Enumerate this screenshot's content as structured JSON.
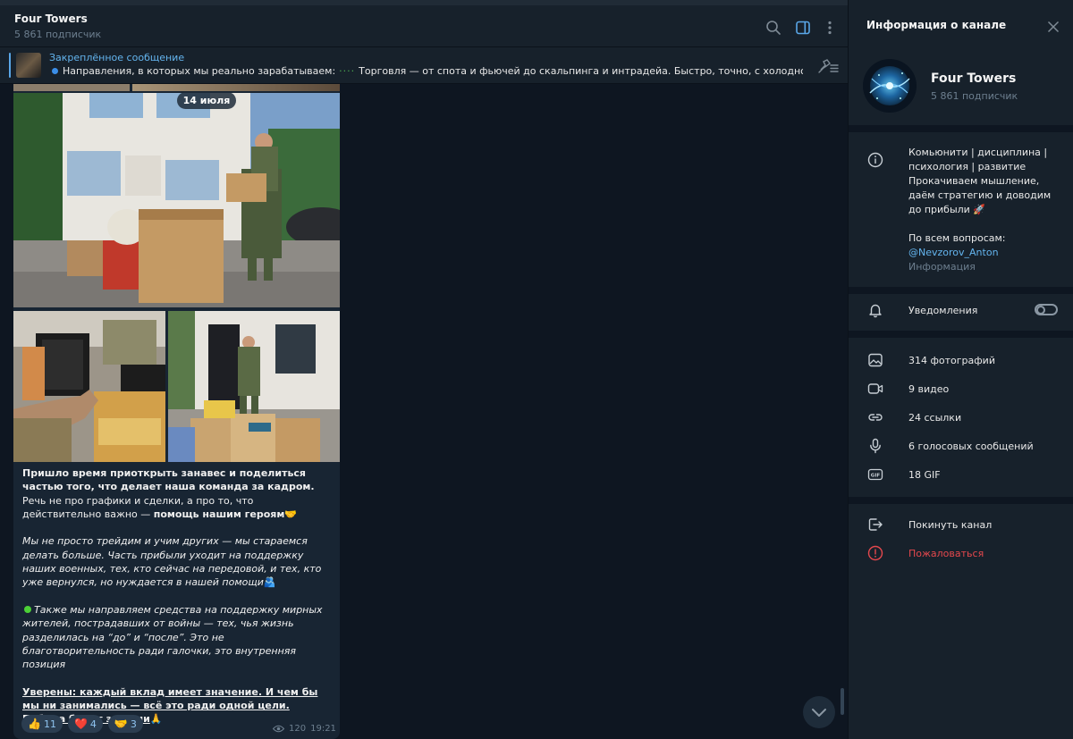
{
  "chat": {
    "title": "Four Towers",
    "subscribers": "5 861 подписчик"
  },
  "pinned": {
    "title": "Закреплённое сообщение",
    "text_part1": "Направления, в которых мы реально зарабатываем:",
    "text_part2": "Торговля — от спота и фьючей до скальпинга и интрадейа. Быстро, точно, с холодной головой ..."
  },
  "message": {
    "date": "14 июля",
    "p1_bold": "Пришло время приоткрыть занавес и поделиться частью того, что делает наша команда за кадром.",
    "p1_normal": " Речь не про графики и сделки, а про то, что действительно важно — ",
    "p1_bold2": "помощь нашим героям",
    "p1_emoji": "🤝",
    "p2": "Мы не просто трейдим и учим других — мы стараемся делать больше. Часть прибыли уходит на поддержку наших военных, тех, кто сейчас на передовой, и тех, кто уже вернулся, но нуждается в нашей помощи",
    "p2_emoji": "🫂",
    "p3": "Также мы направляем средства на поддержку мирных жителей, пострадавших от войны — тех, чья жизнь разделилась на “до” и “после”. Это не благотворительность ради галочки, это внутренняя позиция",
    "p4": "Уверены: каждый вклад имеет значение. И чем бы мы ни занимались — всё это ради одной цели. Победа будет за нами",
    "p4_emoji": "🙏",
    "views": "120",
    "time": "19:21",
    "reactions": [
      {
        "emoji": "👍",
        "count": "11"
      },
      {
        "emoji": "❤️",
        "count": "4"
      },
      {
        "emoji": "🤝",
        "count": "3"
      }
    ]
  },
  "info": {
    "header_title": "Информация о канале",
    "name": "Four Towers",
    "subscribers": "5 861 подписчик",
    "about_line1": "Комьюнити | дисциплина | психология | развитие",
    "about_line2": "Прокачиваем мышление, даём стратегию и доводим до прибыли",
    "about_emoji": "🚀",
    "about_line3": "По всем вопросам:",
    "about_link": "@Nevzorov_Anton",
    "about_caption": "Информация",
    "notifications_label": "Уведомления",
    "notifications_on": false,
    "media": [
      {
        "icon": "photo-icon",
        "label": "314 фотографий"
      },
      {
        "icon": "video-icon",
        "label": "9 видео"
      },
      {
        "icon": "link-icon",
        "label": "24 ссылки"
      },
      {
        "icon": "microphone-icon",
        "label": "6 голосовых сообщений"
      },
      {
        "icon": "gif-icon",
        "label": "18 GIF"
      }
    ],
    "leave_label": "Покинуть канал",
    "report_label": "Пожаловаться"
  },
  "colors": {
    "accent": "#64b5ef",
    "danger": "#e5484d",
    "panel": "#17212b",
    "background": "#0e1621"
  }
}
